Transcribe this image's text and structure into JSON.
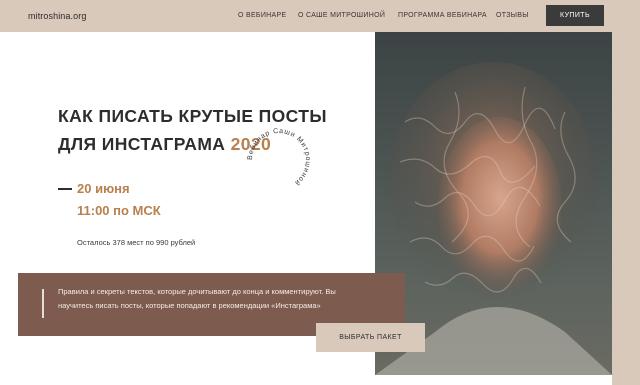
{
  "header": {
    "logo": "mitroshina.org",
    "nav": [
      {
        "label": "О ВЕБИНАРЕ"
      },
      {
        "label": "О САШЕ МИТРОШИНОЙ"
      },
      {
        "label": "ПРОГРАММА ВЕБИНАРА"
      },
      {
        "label": "ОТЗЫВЫ"
      }
    ],
    "buy_label": "КУПИТЬ"
  },
  "hero": {
    "title_line1": "КАК ПИСАТЬ КРУТЫЕ ПОСТЫ",
    "title_line2": "ДЛЯ ИНСТАГРАМА",
    "title_year": "2020",
    "stamp_text": "Вебинар Саши Митрошиной",
    "date": "20 июня",
    "time": "11:00 по МСК",
    "seats": "Осталось 378 мест по 990 рублей",
    "description": "Правила и секреты текстов, которые дочитывают до конца и комментируют. Вы научитесь писать посты, которые попадают в рекомендации «Инстаграма»",
    "package_button": "ВЫБРАТЬ ПАКЕТ"
  },
  "colors": {
    "header_bg": "#d9c9bb",
    "accent": "#b7804f",
    "info_box_bg": "#7d5c4f",
    "dark_button": "#3b3b3b"
  },
  "icons": [
    "circular-stamp-icon"
  ]
}
